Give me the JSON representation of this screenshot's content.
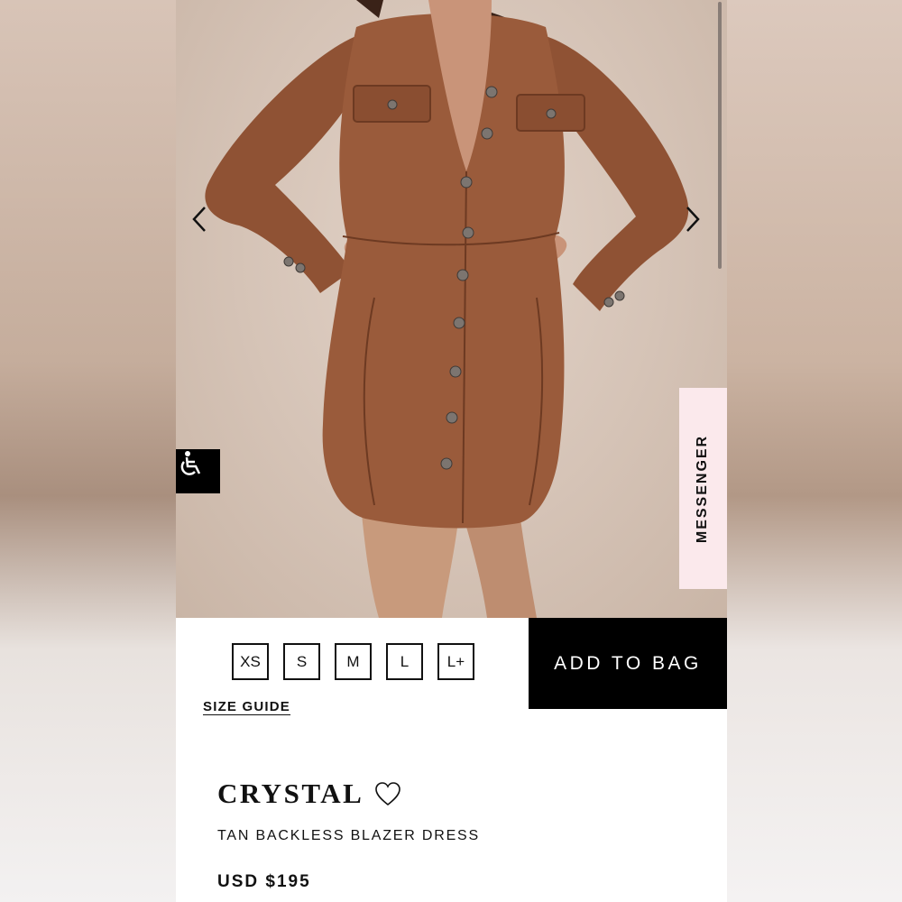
{
  "gallery": {
    "prev_icon": "chevron-left-icon",
    "next_icon": "chevron-right-icon",
    "accessibility_icon": "wheelchair-icon",
    "messenger_label": "MESSENGER"
  },
  "sizes": [
    "XS",
    "S",
    "M",
    "L",
    "L+"
  ],
  "size_guide_label": "SIZE GUIDE",
  "add_to_bag_label": "ADD TO BAG",
  "product": {
    "name": "CRYSTAL",
    "favorite_icon": "heart-outline-icon",
    "subtitle": "TAN BACKLESS BLAZER DRESS",
    "price": "USD $195"
  },
  "colors": {
    "dress": "#9a5b3b",
    "backdrop": "#d8c8bc",
    "messenger_bg": "#fbe9ec",
    "button_bg": "#000000"
  }
}
